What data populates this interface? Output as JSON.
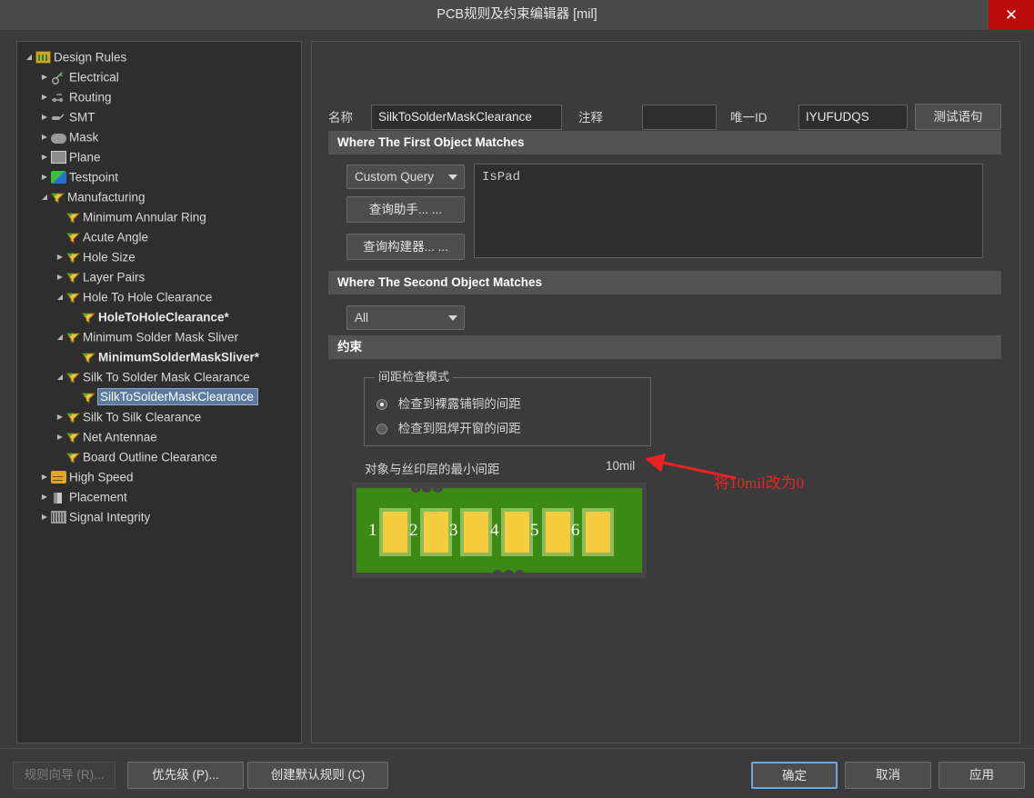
{
  "window": {
    "title": "PCB规则及约束编辑器 [mil]",
    "close_label": "✕",
    "close_color": "#b90b0b"
  },
  "tree": {
    "items": [
      {
        "label": "Design Rules",
        "depth": 0,
        "arrow": "down",
        "icon": "folder-icon",
        "bold": false,
        "selected": false
      },
      {
        "label": "Electrical",
        "depth": 1,
        "arrow": "right",
        "icon": "electrical-icon",
        "bold": false,
        "selected": false
      },
      {
        "label": "Routing",
        "depth": 1,
        "arrow": "right",
        "icon": "routing-icon",
        "bold": false,
        "selected": false
      },
      {
        "label": "SMT",
        "depth": 1,
        "arrow": "right",
        "icon": "smt-icon",
        "bold": false,
        "selected": false
      },
      {
        "label": "Mask",
        "depth": 1,
        "arrow": "right",
        "icon": "mask-icon",
        "bold": false,
        "selected": false
      },
      {
        "label": "Plane",
        "depth": 1,
        "arrow": "right",
        "icon": "plane-icon",
        "bold": false,
        "selected": false
      },
      {
        "label": "Testpoint",
        "depth": 1,
        "arrow": "right",
        "icon": "testpoint-icon",
        "bold": false,
        "selected": false
      },
      {
        "label": "Manufacturing",
        "depth": 1,
        "arrow": "down",
        "icon": "flag-icon",
        "bold": false,
        "selected": false
      },
      {
        "label": "Minimum Annular Ring",
        "depth": 2,
        "arrow": "none",
        "icon": "flag-icon",
        "bold": false,
        "selected": false
      },
      {
        "label": "Acute Angle",
        "depth": 2,
        "arrow": "none",
        "icon": "flag-icon",
        "bold": false,
        "selected": false
      },
      {
        "label": "Hole Size",
        "depth": 2,
        "arrow": "right",
        "icon": "flag-icon",
        "bold": false,
        "selected": false
      },
      {
        "label": "Layer Pairs",
        "depth": 2,
        "arrow": "right",
        "icon": "flag-icon",
        "bold": false,
        "selected": false
      },
      {
        "label": "Hole To Hole Clearance",
        "depth": 2,
        "arrow": "down",
        "icon": "flag-icon",
        "bold": false,
        "selected": false
      },
      {
        "label": "HoleToHoleClearance*",
        "depth": 3,
        "arrow": "none",
        "icon": "flag-icon",
        "bold": true,
        "selected": false
      },
      {
        "label": "Minimum Solder Mask Sliver",
        "depth": 2,
        "arrow": "down",
        "icon": "flag-icon",
        "bold": false,
        "selected": false
      },
      {
        "label": "MinimumSolderMaskSliver*",
        "depth": 3,
        "arrow": "none",
        "icon": "flag-icon",
        "bold": true,
        "selected": false
      },
      {
        "label": "Silk To Solder Mask Clearance",
        "depth": 2,
        "arrow": "down",
        "icon": "flag-icon",
        "bold": false,
        "selected": false
      },
      {
        "label": "SilkToSolderMaskClearance",
        "depth": 3,
        "arrow": "none",
        "icon": "flag-icon",
        "bold": false,
        "selected": true
      },
      {
        "label": "Silk To Silk Clearance",
        "depth": 2,
        "arrow": "right",
        "icon": "flag-icon",
        "bold": false,
        "selected": false
      },
      {
        "label": "Net Antennae",
        "depth": 2,
        "arrow": "right",
        "icon": "flag-icon",
        "bold": false,
        "selected": false
      },
      {
        "label": "Board Outline Clearance",
        "depth": 2,
        "arrow": "none",
        "icon": "flag-icon",
        "bold": false,
        "selected": false
      },
      {
        "label": "High Speed",
        "depth": 1,
        "arrow": "right",
        "icon": "highspeed-icon",
        "bold": false,
        "selected": false
      },
      {
        "label": "Placement",
        "depth": 1,
        "arrow": "right",
        "icon": "placement-icon",
        "bold": false,
        "selected": false
      },
      {
        "label": "Signal Integrity",
        "depth": 1,
        "arrow": "right",
        "icon": "signalintegrity-icon",
        "bold": false,
        "selected": false
      }
    ],
    "selection_color": "#5c7a9e"
  },
  "form": {
    "name_label": "名称",
    "name_value": "SilkToSolderMaskClearance",
    "comment_label": "注释",
    "comment_value": "",
    "comment_placeholder": "",
    "uid_label": "唯一ID",
    "uid_value": "IYUFUDQS",
    "test_query_label": "测试语句"
  },
  "first_object": {
    "header": "Where The First Object Matches",
    "scope_value": "Custom Query",
    "query_helper_label": "查询助手... ...",
    "query_builder_label": "查询构建器... ...",
    "query_text": "IsPad"
  },
  "second_object": {
    "header": "Where The Second Object Matches",
    "scope_value": "All"
  },
  "constraints": {
    "header": "约束",
    "group_title": "间距检查模式",
    "options": [
      {
        "label": "检查到裸露铺铜的间距",
        "selected": true
      },
      {
        "label": "检查到阻焊开窗的间距",
        "selected": false
      }
    ],
    "min_clearance_label": "对象与丝印层的最小间距",
    "min_clearance_value": "10mil"
  },
  "pcb_preview": {
    "board_color": "#3b8a14",
    "pad_color": "#f6cc3f",
    "pad_ring_color": "#8dbd5a",
    "pad_numbers": [
      "1",
      "2",
      "3",
      "4",
      "5",
      "6"
    ]
  },
  "annotation": {
    "text": "将10mil改为0",
    "color": "#ee2222"
  },
  "footer": {
    "rule_wizard_label": "规则向导 (R)...",
    "priority_label": "优先级 (P)...",
    "create_default_label": "创建默认规则 (C)",
    "ok_label": "确定",
    "cancel_label": "取消",
    "apply_label": "应用"
  }
}
